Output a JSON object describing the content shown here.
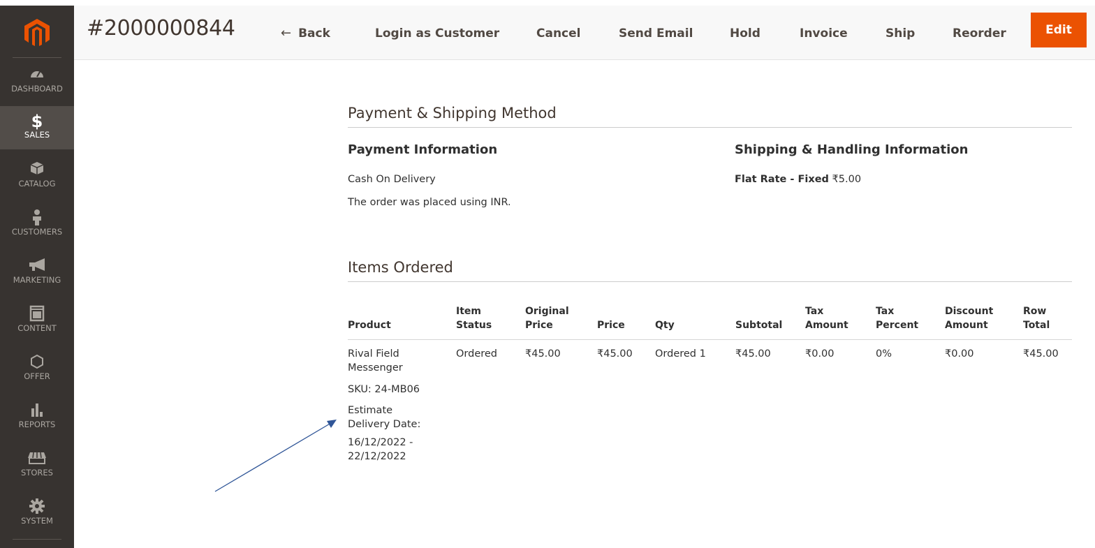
{
  "sidebar": {
    "items": [
      {
        "label": "DASHBOARD",
        "icon": "dashboard-icon",
        "active": false
      },
      {
        "label": "SALES",
        "icon": "dollar-icon",
        "active": true
      },
      {
        "label": "CATALOG",
        "icon": "box-icon",
        "active": false
      },
      {
        "label": "CUSTOMERS",
        "icon": "person-icon",
        "active": false
      },
      {
        "label": "MARKETING",
        "icon": "megaphone-icon",
        "active": false
      },
      {
        "label": "CONTENT",
        "icon": "layout-icon",
        "active": false
      },
      {
        "label": "OFFER",
        "icon": "hexagon-icon",
        "active": false
      },
      {
        "label": "REPORTS",
        "icon": "bar-chart-icon",
        "active": false
      },
      {
        "label": "STORES",
        "icon": "store-icon",
        "active": false
      },
      {
        "label": "SYSTEM",
        "icon": "gear-icon",
        "active": false
      }
    ]
  },
  "header": {
    "order_number": "#2000000844",
    "back_label": "Back",
    "back_arrow": "←",
    "actions": [
      "Login as Customer",
      "Cancel",
      "Send Email",
      "Hold",
      "Invoice",
      "Ship",
      "Reorder"
    ],
    "edit_label": "Edit"
  },
  "colors": {
    "accent": "#eb5202",
    "sidebar_bg": "#373330",
    "sidebar_active": "#524d49"
  },
  "payment_shipping": {
    "title": "Payment & Shipping Method",
    "payment": {
      "heading": "Payment Information",
      "method": "Cash On Delivery",
      "currency_note": "The order was placed using INR."
    },
    "shipping": {
      "heading": "Shipping & Handling Information",
      "method": "Flat Rate - Fixed",
      "amount": "₹5.00"
    }
  },
  "items_ordered": {
    "title": "Items Ordered",
    "columns": [
      "Product",
      "Item\nStatus",
      "Original\nPrice",
      "Price",
      "Qty",
      "Subtotal",
      "Tax\nAmount",
      "Tax\nPercent",
      "Discount\nAmount",
      "Row\nTotal"
    ],
    "rows": [
      {
        "product_name": "Rival Field\nMessenger",
        "sku": "SKU: 24-MB06",
        "delivery_label": "Estimate\nDelivery Date:",
        "delivery_range": "16/12/2022 -\n22/12/2022",
        "status": "Ordered",
        "original_price": "₹45.00",
        "price": "₹45.00",
        "qty": "Ordered 1",
        "subtotal": "₹45.00",
        "tax_amount": "₹0.00",
        "tax_percent": "0%",
        "discount_amount": "₹0.00",
        "row_total": "₹45.00"
      }
    ]
  }
}
